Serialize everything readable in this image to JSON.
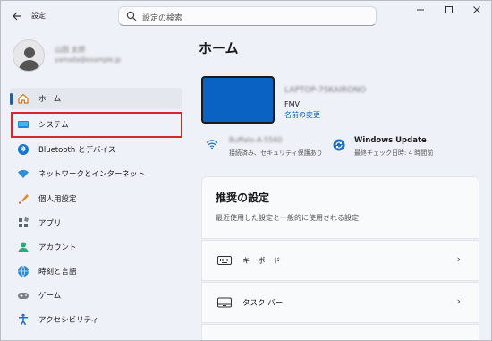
{
  "window": {
    "title": "設定"
  },
  "search": {
    "placeholder": "設定の検索"
  },
  "user": {
    "name": "山田 太郎",
    "email": "yamada@example.jp"
  },
  "nav": [
    {
      "label": "ホーム",
      "icon": "home-icon",
      "active": true
    },
    {
      "label": "システム",
      "icon": "system-icon",
      "highlighted": true
    },
    {
      "label": "Bluetooth とデバイス",
      "icon": "bluetooth-icon"
    },
    {
      "label": "ネットワークとインターネット",
      "icon": "network-icon"
    },
    {
      "label": "個人用設定",
      "icon": "personalization-icon"
    },
    {
      "label": "アプリ",
      "icon": "apps-icon"
    },
    {
      "label": "アカウント",
      "icon": "account-icon"
    },
    {
      "label": "時刻と言語",
      "icon": "time-language-icon"
    },
    {
      "label": "ゲーム",
      "icon": "gaming-icon"
    },
    {
      "label": "アクセシビリティ",
      "icon": "accessibility-icon"
    }
  ],
  "main": {
    "title": "ホーム",
    "device": {
      "name": "LAPTOP-7SKAIRONO",
      "model": "FMV",
      "rename": "名前の変更"
    },
    "network": {
      "name": "Buffalo-A-5560",
      "status": "接続済み、セキュリティ保護あり"
    },
    "update": {
      "title": "Windows Update",
      "status": "最終チェック日時: 4 時間前"
    },
    "recommended": {
      "title": "推奨の設定",
      "subtitle": "最近使用した設定と一般的に使用される設定",
      "items": [
        {
          "label": "キーボード",
          "icon": "keyboard-icon"
        },
        {
          "label": "タスク バー",
          "icon": "taskbar-icon"
        }
      ]
    }
  },
  "colors": {
    "accent": "#0a64c8",
    "highlight_border": "#d9262c",
    "device_screen": "#0a63c2"
  }
}
